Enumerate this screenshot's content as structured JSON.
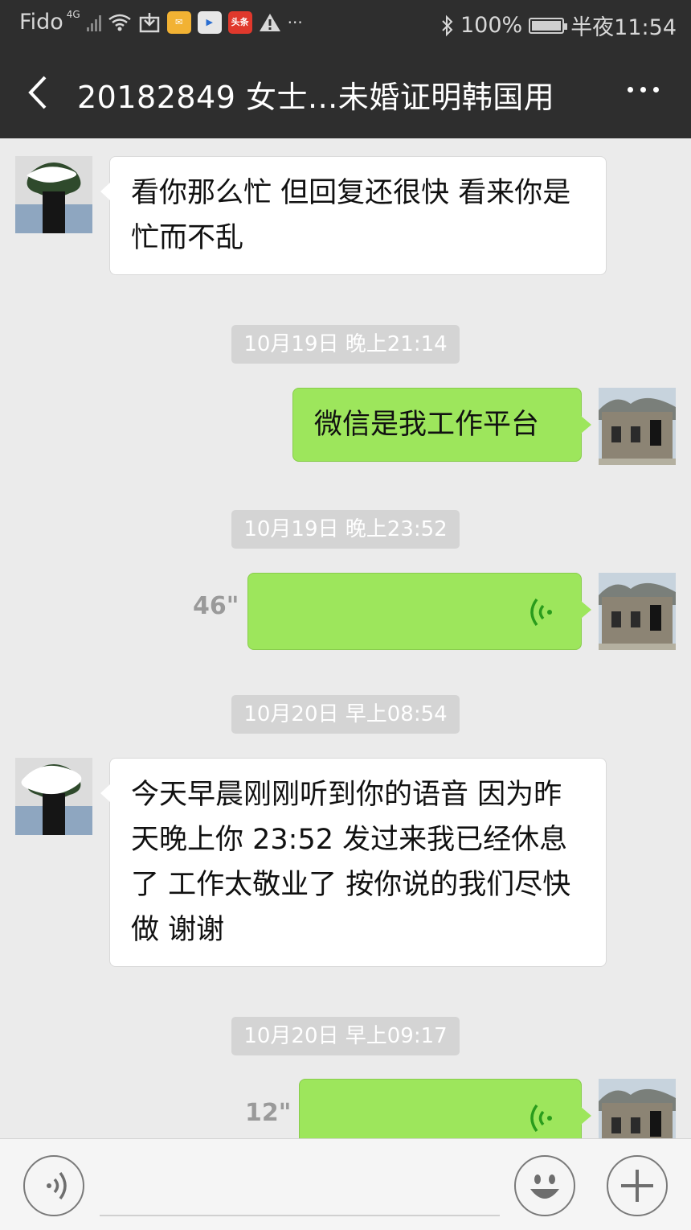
{
  "status_bar": {
    "carrier": "Fido",
    "network": "4G",
    "battery": "100%",
    "time": "半夜11:54",
    "icons": [
      "signal-icon",
      "wifi-icon",
      "download-icon",
      "mail-app-icon",
      "video-app-icon",
      "toutiao-app-icon",
      "warning-icon",
      "more-notifications-icon",
      "bluetooth-icon",
      "battery-icon"
    ],
    "toutiao_label": "头条",
    "more_label": "···"
  },
  "header": {
    "title": "20182849 女士...未婚证明韩国用",
    "back_icon": "back-chevron-icon",
    "more_icon": "more-dots-icon"
  },
  "messages": [
    {
      "type": "text",
      "direction": "in",
      "text": "看你那么忙 但回复还很快 看来你是忙而不乱"
    },
    {
      "type": "timestamp",
      "text": "10月19日 晚上21:14"
    },
    {
      "type": "text",
      "direction": "out",
      "text": "微信是我工作平台"
    },
    {
      "type": "timestamp",
      "text": "10月19日 晚上23:52"
    },
    {
      "type": "voice",
      "direction": "out",
      "duration": "46\""
    },
    {
      "type": "timestamp",
      "text": "10月20日 早上08:54"
    },
    {
      "type": "text",
      "direction": "in",
      "text": "今天早晨刚刚听到你的语音 因为昨天晚上你 23:52 发过来我已经休息了 工作太敬业了 按你说的我们尽快做 谢谢"
    },
    {
      "type": "timestamp",
      "text": "10月20日 早上09:17"
    },
    {
      "type": "voice",
      "direction": "out",
      "duration": "12\""
    }
  ],
  "input_bar": {
    "voice_toggle_icon": "voice-input-icon",
    "emoji_icon": "emoji-icon",
    "plus_icon": "plus-icon",
    "text_value": ""
  },
  "colors": {
    "bar": "#2e2e2e",
    "background": "#ebebeb",
    "outgoing_bubble": "#9de65c",
    "incoming_bubble": "#ffffff",
    "voice_wave": "#2a9c1c"
  }
}
